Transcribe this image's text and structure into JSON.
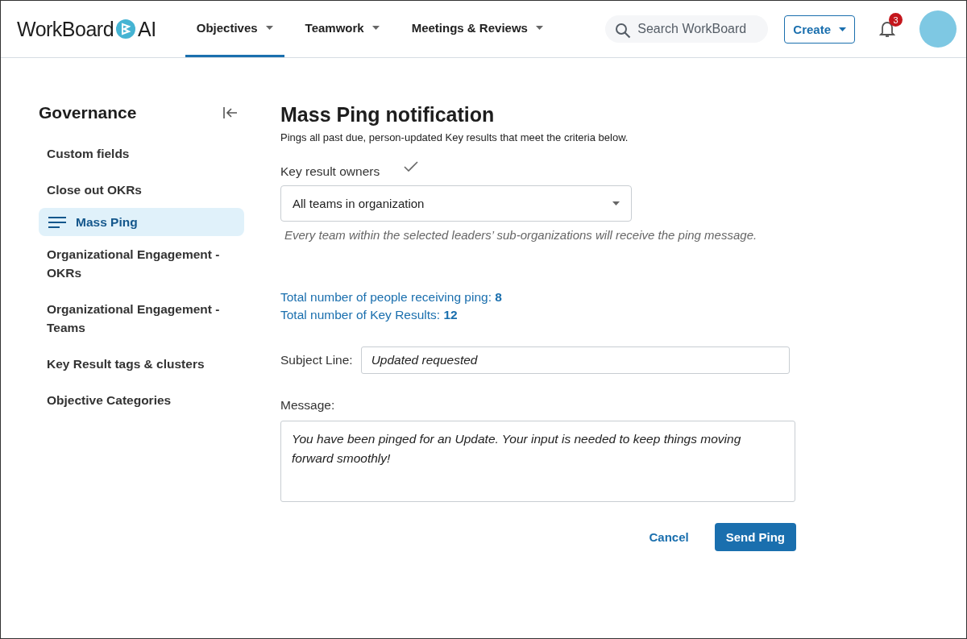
{
  "header": {
    "logo": {
      "name": "WorkBoard",
      "suffix": "AI"
    },
    "nav": [
      {
        "label": "Objectives",
        "selected": true
      },
      {
        "label": "Teamwork",
        "selected": false
      },
      {
        "label": "Meetings & Reviews",
        "selected": false
      }
    ],
    "search": {
      "placeholder": "Search WorkBoard"
    },
    "create_button": "Create",
    "notifications": {
      "count": "3"
    }
  },
  "sidebar": {
    "title": "Governance",
    "items": [
      {
        "label": "Custom fields",
        "selected": false
      },
      {
        "label": "Close out OKRs",
        "selected": false
      },
      {
        "label": "Mass Ping",
        "selected": true
      },
      {
        "label": "Organizational Engagement - OKRs",
        "selected": false
      },
      {
        "label": "Organizational Engagement - Teams",
        "selected": false
      },
      {
        "label": "Key Result tags & clusters",
        "selected": false
      },
      {
        "label": "Objective Categories",
        "selected": false
      }
    ]
  },
  "main": {
    "title": "Mass Ping notification",
    "subtitle": "Pings all past due, person-updated Key results that meet the criteria below.",
    "owners": {
      "label": "Key result owners",
      "value": "All teams in organization",
      "hint": "Every team within the selected leaders’ sub-organizations will receive the ping message."
    },
    "totals": [
      "Total number of people receiving ping: **8**",
      "Total number of Key Results: **12**"
    ],
    "subject": {
      "label": "Subject Line:",
      "value": "Updated requested"
    },
    "message": {
      "label": "Message:",
      "value": "You have been pinged for an Update. Your input is needed to keep things moving forward smoothly!"
    },
    "buttons": {
      "cancel": "Cancel",
      "submit": "Send Ping"
    }
  }
}
